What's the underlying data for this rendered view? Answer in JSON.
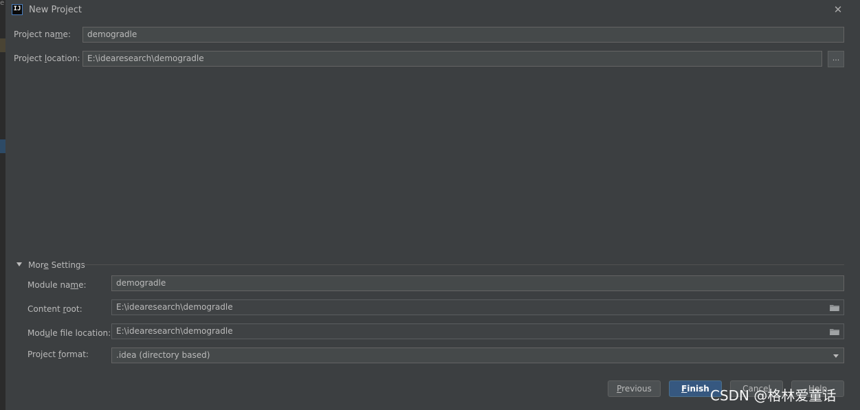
{
  "window": {
    "title": "New Project",
    "app_icon_text": "IJ"
  },
  "project": {
    "name_label_pre": "Project na",
    "name_label_u": "m",
    "name_label_post": "e:",
    "name_value": "demogradle",
    "location_label_pre": "Project ",
    "location_label_u": "l",
    "location_label_post": "ocation:",
    "location_value": "E:\\idearesearch\\demogradle",
    "browse_label": "..."
  },
  "more_settings": {
    "label_pre": "Mor",
    "label_u": "e",
    "label_post": " Settings",
    "module_name_label_pre": "Module na",
    "module_name_label_u": "m",
    "module_name_label_post": "e:",
    "module_name_value": "demogradle",
    "content_root_label_pre": "Content ",
    "content_root_label_u": "r",
    "content_root_label_post": "oot:",
    "content_root_value": "E:\\idearesearch\\demogradle",
    "module_file_label_pre": "Mod",
    "module_file_label_u": "u",
    "module_file_label_post": "le file location:",
    "module_file_value": "E:\\idearesearch\\demogradle",
    "format_label_pre": "Project ",
    "format_label_u": "f",
    "format_label_post": "ormat:",
    "format_value": ".idea (directory based)"
  },
  "buttons": {
    "previous_u": "P",
    "previous_rest": "revious",
    "finish_u": "F",
    "finish_rest": "inish",
    "cancel": "Cancel",
    "help": "Help"
  },
  "watermark": "CSDN @格林爱童话",
  "colors": {
    "background": "#3c3f41",
    "field": "#45494a",
    "primary_button": "#365880",
    "text": "#bbbbbb"
  }
}
